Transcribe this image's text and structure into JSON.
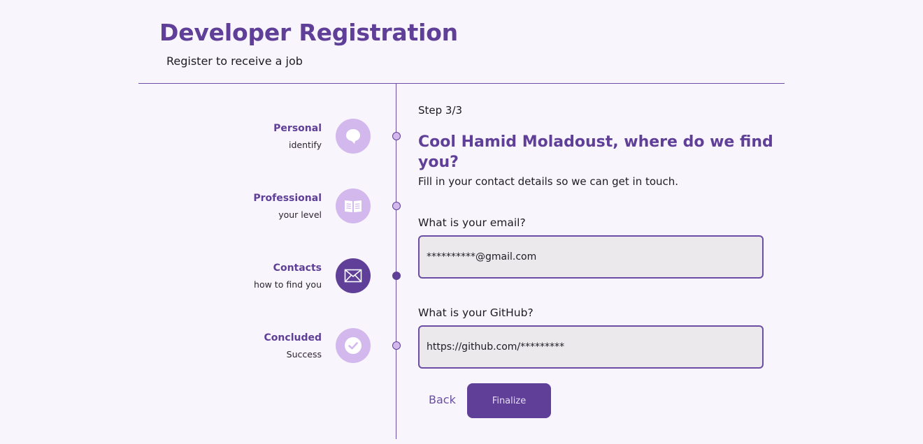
{
  "header": {
    "title": "Developer Registration",
    "subtitle": "Register to receive a job"
  },
  "steps": [
    {
      "label": "Personal",
      "sublabel": "identify",
      "icon": "user-bubble-icon",
      "active": false
    },
    {
      "label": "Professional",
      "sublabel": "your level",
      "icon": "book-icon",
      "active": false
    },
    {
      "label": "Contacts",
      "sublabel": "how to find you",
      "icon": "envelope-icon",
      "active": true
    },
    {
      "label": "Concluded",
      "sublabel": "Success",
      "icon": "check-icon",
      "active": false
    }
  ],
  "form": {
    "step_counter": "Step 3/3",
    "heading": "Cool Hamid Moladoust, where do we find you?",
    "description": "Fill in your contact details so we can get in touch.",
    "email_label": "What is your email?",
    "email_value": "**********@gmail.com",
    "github_label": "What is your GitHub?",
    "github_value": "https://github.com/*********",
    "back_label": "Back",
    "finalize_label": "Finalize"
  },
  "colors": {
    "accent": "#5f3f98",
    "accent_light": "#d3b8ee",
    "background": "#f8f5fc",
    "input_background": "#ebe9ec"
  }
}
